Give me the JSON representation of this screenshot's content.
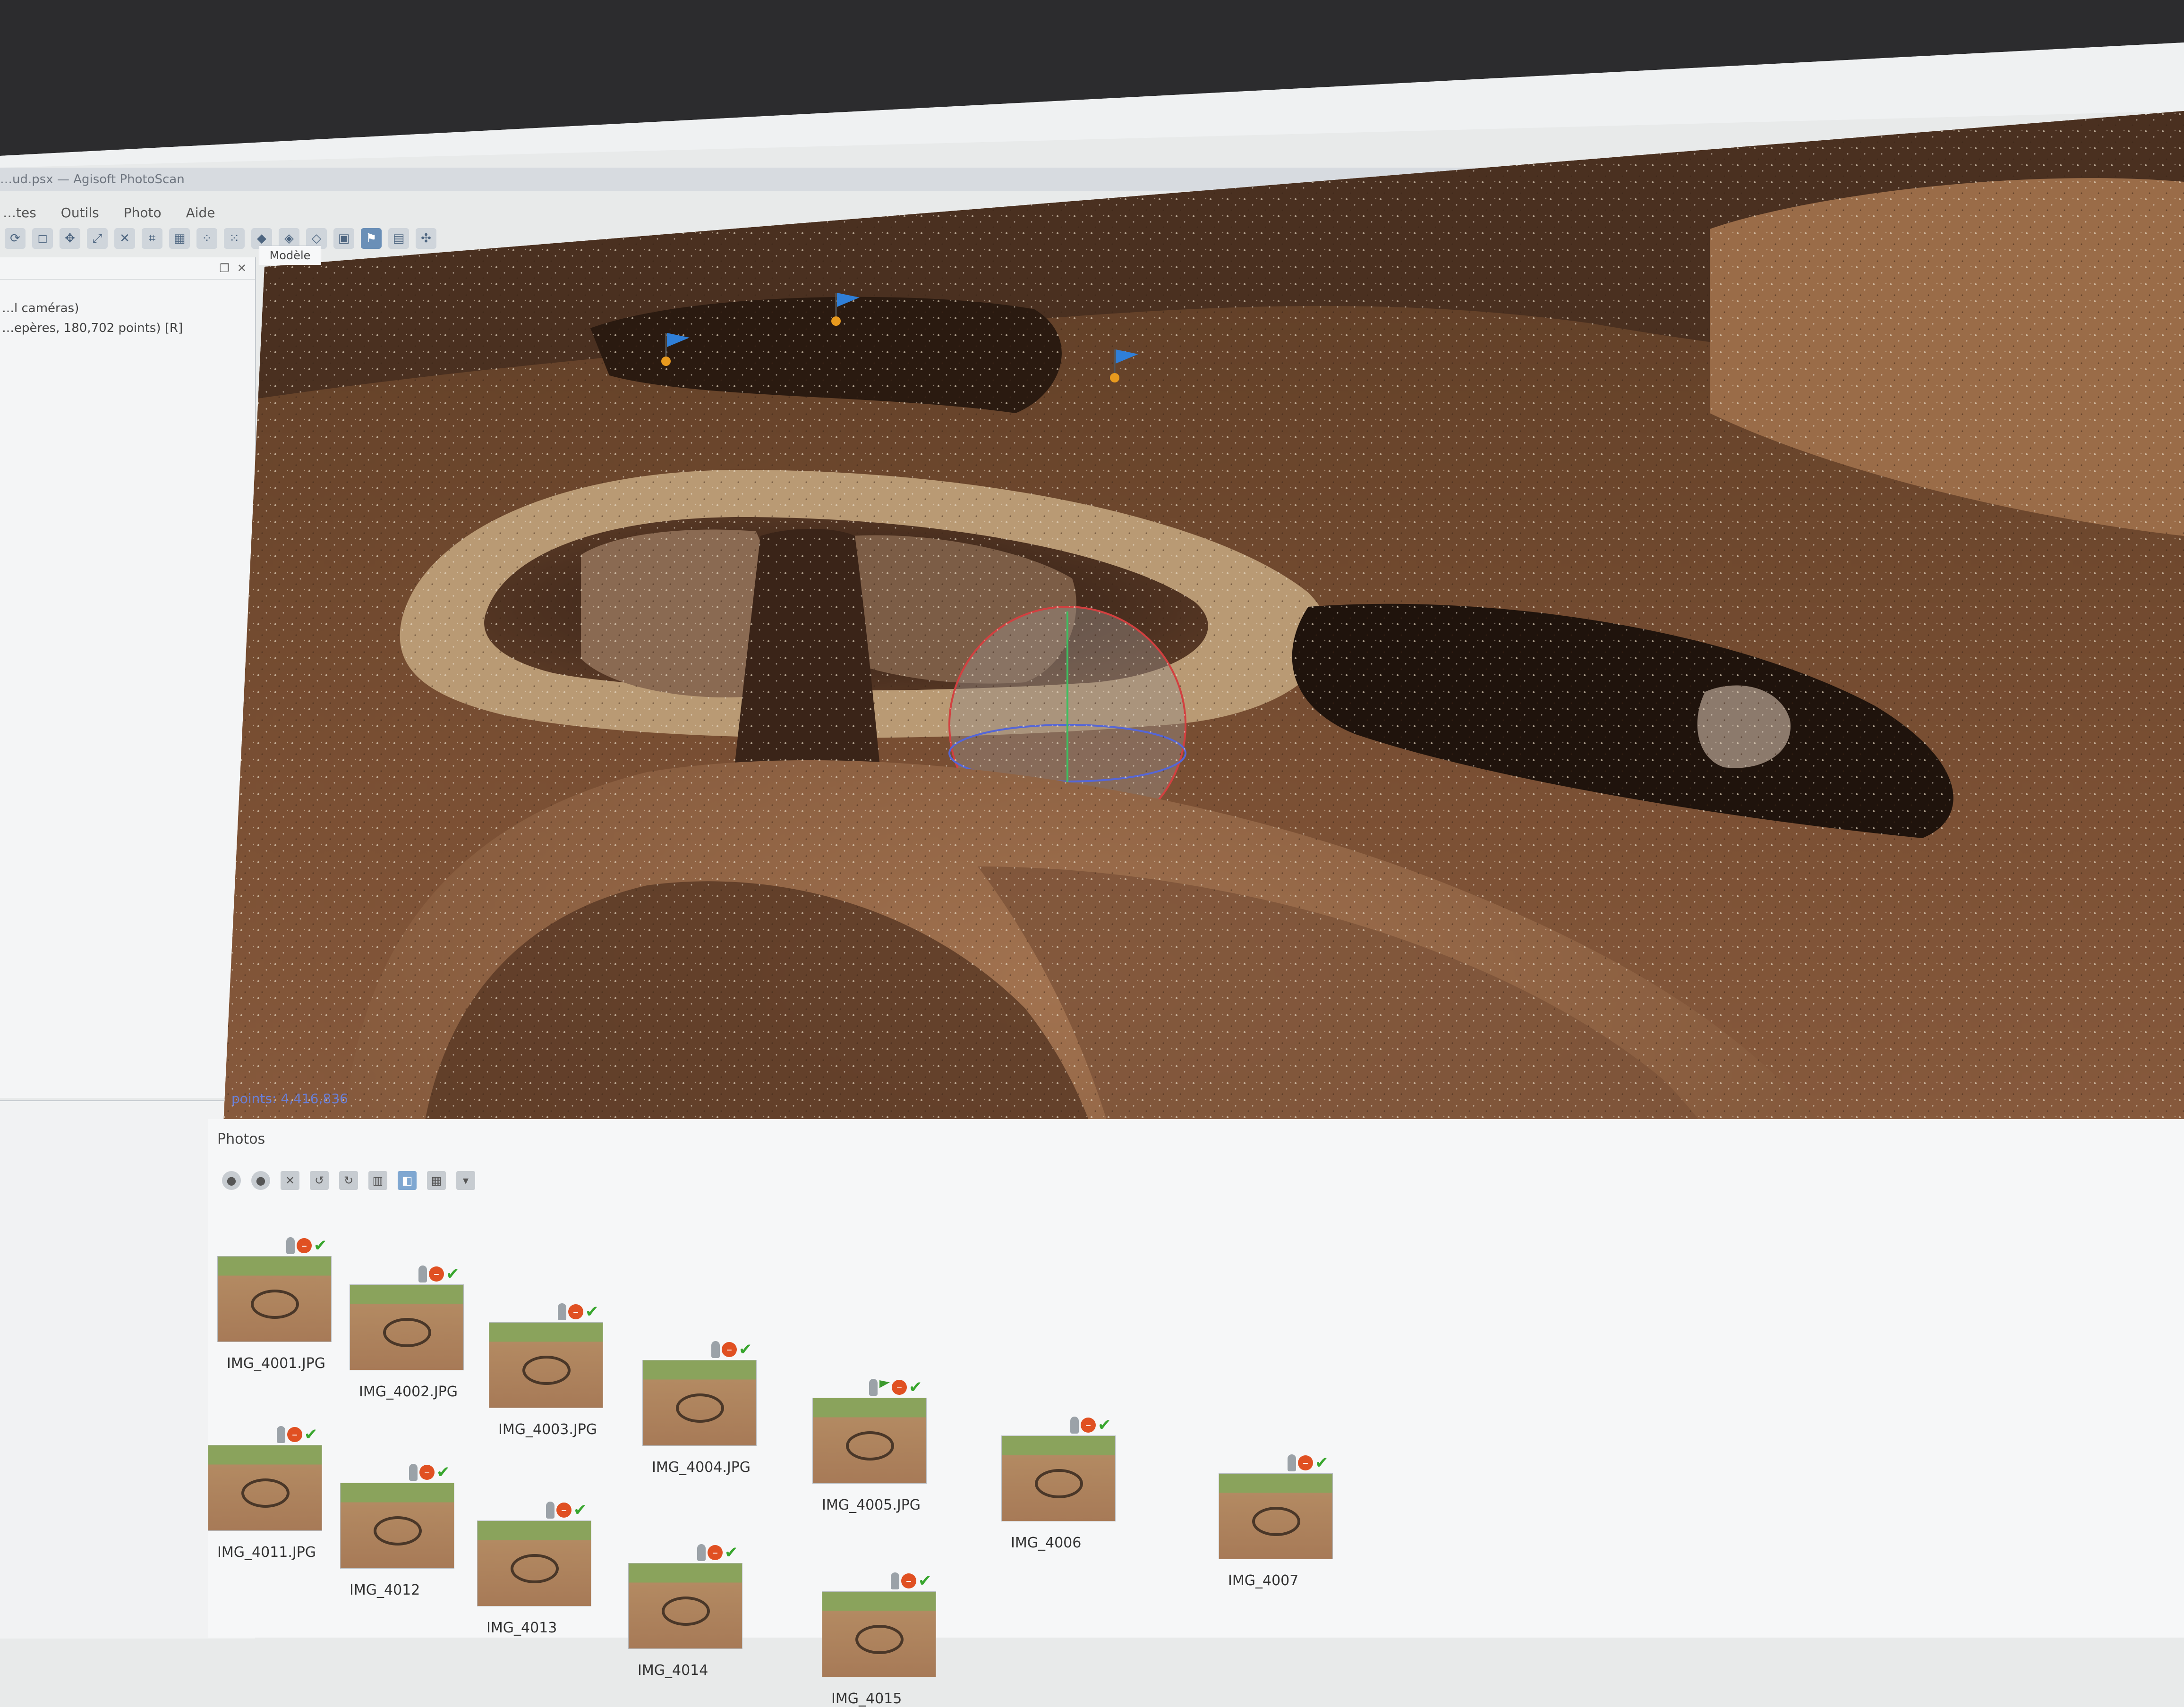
{
  "window": {
    "title": "…ud.psx — Agisoft PhotoScan"
  },
  "menu": [
    "…tes",
    "Outils",
    "Photo",
    "Aide"
  ],
  "toolbar": {
    "icons": [
      "rotate-icon",
      "region-icon",
      "move-icon",
      "resize-icon",
      "close-icon",
      "crop-icon",
      "grid-icon",
      "points-icon",
      "dense-cloud-icon",
      "mesh-icon",
      "shaded-icon",
      "textured-icon",
      "camera-icon",
      "show-cameras-icon",
      "show-markers-icon",
      "align-icon",
      "navigate-icon"
    ],
    "active": [
      "show-cameras-icon"
    ]
  },
  "workspace": {
    "line1": "…l caméras)",
    "line2": "…epères, 180,702 points) [R]"
  },
  "model_tab": "Modèle",
  "viewport": {
    "points_label": "points: 4,416,836",
    "markers": [
      "marker-1",
      "marker-2",
      "marker-3"
    ]
  },
  "photos_panel": {
    "title": "Photos",
    "photos": [
      {
        "name": "IMG_4001.JPG",
        "aligned": true,
        "flag": false
      },
      {
        "name": "IMG_4002.JPG",
        "aligned": true,
        "flag": false
      },
      {
        "name": "IMG_4003.JPG",
        "aligned": true,
        "flag": false
      },
      {
        "name": "IMG_4004.JPG",
        "aligned": true,
        "flag": false
      },
      {
        "name": "IMG_4005.JPG",
        "aligned": true,
        "flag": true
      },
      {
        "name": "IMG_4006",
        "aligned": true,
        "flag": false
      },
      {
        "name": "IMG_4007",
        "aligned": true,
        "flag": false
      },
      {
        "name": "IMG_4011.JPG",
        "aligned": true,
        "flag": false
      },
      {
        "name": "IMG_4012",
        "aligned": true,
        "flag": false
      },
      {
        "name": "IMG_4013",
        "aligned": true,
        "flag": false
      },
      {
        "name": "IMG_4014",
        "aligned": true,
        "flag": false
      },
      {
        "name": "IMG_4015",
        "aligned": true,
        "flag": false
      }
    ]
  },
  "colors": {
    "soil_light": "#c9a97d",
    "soil_dark": "#4a2e1c",
    "marker_blue": "#2f7fd8",
    "marker_orange": "#e89a1e",
    "status_check": "#38a62e",
    "status_stop": "#e05022"
  }
}
